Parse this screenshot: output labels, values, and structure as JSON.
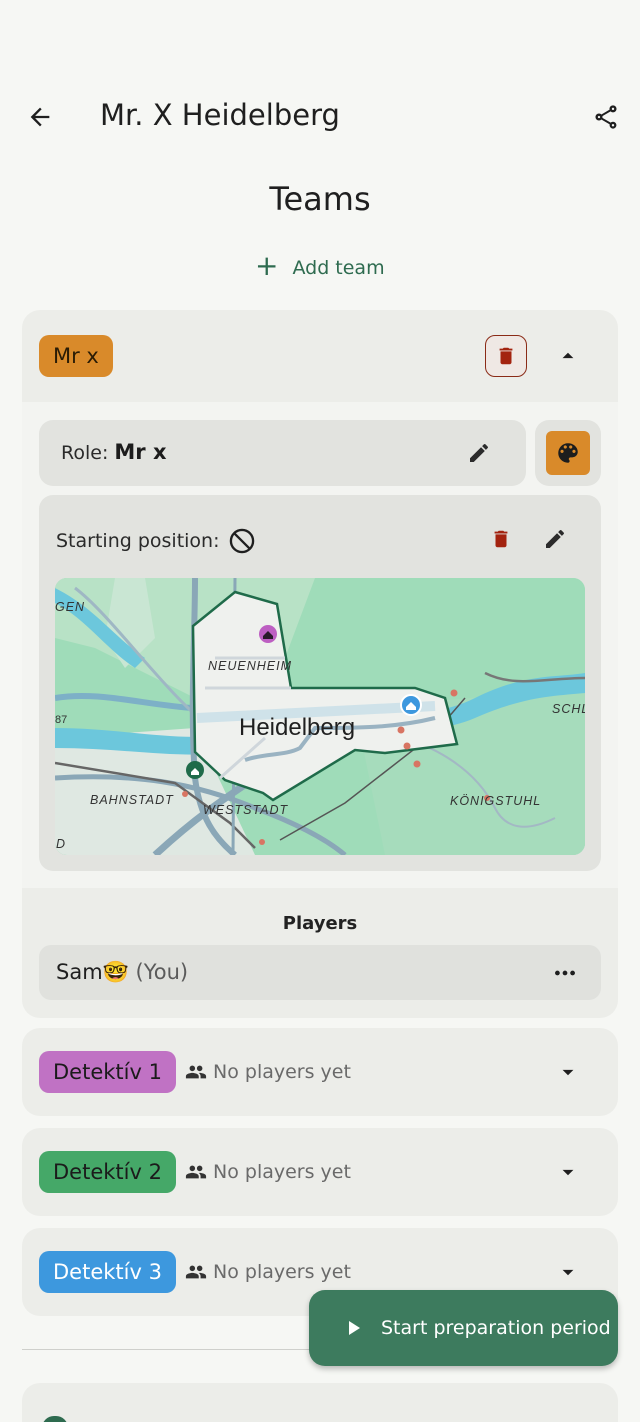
{
  "appbar": {
    "title": "Mr. X Heidelberg"
  },
  "section": {
    "title": "Teams",
    "add_team_label": "Add team"
  },
  "mrx_team": {
    "name": "Mr x",
    "role_prefix": "Role:",
    "role_value": "Mr x",
    "starting_position_label": "Starting position:",
    "players_title": "Players",
    "player": {
      "name": "Sam🤓",
      "suffix": "(You)"
    },
    "color": "#d98a2a"
  },
  "map": {
    "city": "Heidelberg",
    "labels": [
      "NEUENHEIM",
      "BAHNSTADT",
      "WESTSTADT",
      "KÖNIGSTUHL",
      "SCHL",
      "GEN",
      "D",
      "87"
    ]
  },
  "teams": [
    {
      "name": "Detektív  1",
      "status": "No players yet",
      "color": "#c072c4"
    },
    {
      "name": "Detektív  2",
      "status": "No players yet",
      "color": "#45a868"
    },
    {
      "name": "Detektív  3",
      "status": "No players yet",
      "color": "#3d98de"
    }
  ],
  "fab": {
    "label": "Start preparation period"
  },
  "colors": {
    "accent": "#2e6b4f",
    "fab": "#3d7b5e",
    "danger": "#a3230f"
  }
}
